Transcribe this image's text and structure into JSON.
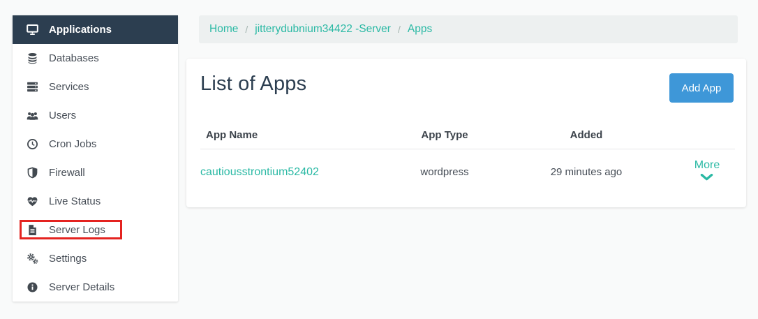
{
  "sidebar": {
    "items": [
      {
        "label": "Applications",
        "icon": "desktop-icon",
        "active": true
      },
      {
        "label": "Databases",
        "icon": "database-icon"
      },
      {
        "label": "Services",
        "icon": "server-stack-icon"
      },
      {
        "label": "Users",
        "icon": "users-icon"
      },
      {
        "label": "Cron Jobs",
        "icon": "clock-icon"
      },
      {
        "label": "Firewall",
        "icon": "shield-icon"
      },
      {
        "label": "Live Status",
        "icon": "heartbeat-icon"
      },
      {
        "label": "Server Logs",
        "icon": "file-text-icon",
        "highlighted": true
      },
      {
        "label": "Settings",
        "icon": "gears-icon"
      },
      {
        "label": "Server Details",
        "icon": "info-circle-icon"
      }
    ]
  },
  "breadcrumb": {
    "separator": "/",
    "items": [
      "Home",
      "jitterydubnium34422 -Server",
      "Apps"
    ]
  },
  "main": {
    "title": "List of Apps",
    "add_app_button": "Add App",
    "table": {
      "headers": [
        "App Name",
        "App Type",
        "Added"
      ],
      "rows": [
        {
          "app_name": "cautiousstrontium52402",
          "app_type": "wordpress",
          "added": "29 minutes ago",
          "more_label": "More"
        }
      ]
    }
  },
  "colors": {
    "accent_teal": "#2ab9a4",
    "primary_blue": "#3e97d8",
    "active_nav_bg": "#2c3e50",
    "highlight_red": "#e42320",
    "breadcrumb_bg": "#edf0f0"
  }
}
